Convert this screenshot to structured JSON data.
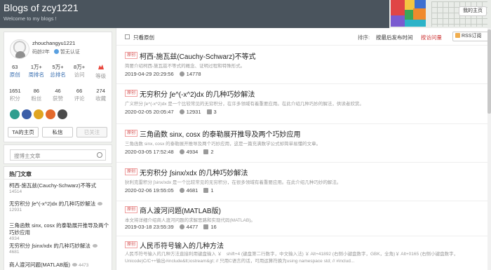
{
  "header": {
    "title": "Blogs of zcy1221",
    "subtitle": "Welcome to my blogs !",
    "back_label": "我的主页"
  },
  "profile": {
    "username": "zhouchangyu1221",
    "tenure": "码龄2年",
    "verification": "暂无认证",
    "stats_row1": [
      {
        "num": "63",
        "label": "原创"
      },
      {
        "num": "1万+",
        "label": "周排名"
      },
      {
        "num": "5万+",
        "label": "总排名"
      },
      {
        "num": "8万+",
        "label": "访问"
      },
      {
        "num": "",
        "label": "等级"
      }
    ],
    "stats_row2": [
      {
        "num": "1651",
        "label": "积分"
      },
      {
        "num": "86",
        "label": "粉丝"
      },
      {
        "num": "46",
        "label": "获赞"
      },
      {
        "num": "66",
        "label": "评论"
      },
      {
        "num": "274",
        "label": "收藏"
      }
    ],
    "actions": {
      "home": "TA的主页",
      "message": "私信",
      "follow": "已关注"
    }
  },
  "search": {
    "placeholder": "搜博主文章"
  },
  "hot": {
    "title": "热门文章",
    "items": [
      {
        "title": "柯西-施瓦兹(Cauchy-Schwarz)不等式",
        "views": "14514"
      },
      {
        "title": "无穷积分 ∫e^(-x^2)dx 的几种巧妙解法",
        "views": "12931"
      },
      {
        "title": "三角函数 sinx, cosx 的泰勒展开推导及两个巧妙应用",
        "views": "4934"
      },
      {
        "title": "无穷积分 ∫sinx/xdx 的几种巧妙解法",
        "views": "4681"
      },
      {
        "title": "商人渡河问题(MATLAB版)",
        "views": "4473"
      }
    ]
  },
  "toolbar": {
    "only_original": "只看原创",
    "sort_label": "排序:",
    "sort_by_time": "按最后发布时间",
    "sort_by_views": "按访问量",
    "rss": "RSS订阅"
  },
  "posts": [
    {
      "tag": "原创",
      "title": "柯西-施瓦兹(Cauchy-Schwarz)不等式",
      "desc": "简要介绍柯西-施瓦兹不等式的概念、证明过程和特殊形式。",
      "date": "2019-04-29 20:29:56",
      "views": "14778",
      "comments": ""
    },
    {
      "tag": "原创",
      "title": "无穷积分 ∫e^(-x^2)dx 的几种巧妙解法",
      "desc": "广义积分 ∫e^(-x^2)dx 是一个比较常见的无穷积分，在许多领域有着重要应用。在此介绍几种巧妙的解法，供读者欣赏。",
      "date": "2020-02-05 20:05:47",
      "views": "12931",
      "comments": "3"
    },
    {
      "tag": "原创",
      "title": "三角函数 sinx, cosx 的泰勒展开推导及两个巧妙应用",
      "desc": "三角函数 sinx, cosx 的泰勒展开推导及两个巧妙应用，这是一篇充满数学公式却简单易懂的文章。",
      "date": "2020-03-05 17:52:48",
      "views": "4934",
      "comments": "2"
    },
    {
      "tag": "原创",
      "title": "无穷积分 ∫sinx/xdx 的几种巧妙解法",
      "desc": "狄利克雷积分 ∫sinx/xdx 是一个比较常见的无穷积分，在很多领域有着重要应用。在此介绍几种巧妙的解法。",
      "date": "2020-02-06 19:55:05",
      "views": "4681",
      "comments": "1"
    },
    {
      "tag": "原创",
      "title": "商人渡河问题(MATLAB版)",
      "desc": "本文将详细介绍商人渡河问题的求解思路和实现代码(MATLAB)。",
      "date": "2019-03-18 23:55:39",
      "views": "4477",
      "comments": "16"
    },
    {
      "tag": "原创",
      "title": "人民币符号输入的几种方法",
      "desc": "人民币符号输入的几种方法直接利用键盘输入 ￥　shift+4 (键盘第二行数字，中文输入法) ￥ Alt+41892 (右侧小键盘数字，GBK，全角)￥ Alt+0165 (右侧小键盘数字，Unicode)C/C++输出#include&lt;iostream&gt; // 只用C语言的话，可用运算符换为using namespace std; // #includ...",
      "date": "",
      "views": "",
      "comments": ""
    }
  ]
}
